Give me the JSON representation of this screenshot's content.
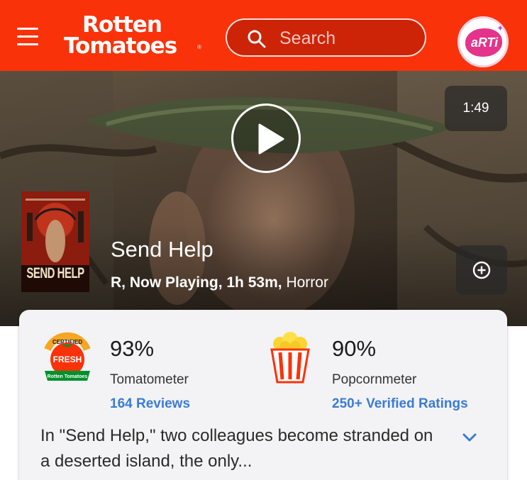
{
  "header": {
    "logo_line1": "Rotten",
    "logo_line2": "Tomatoes",
    "logo_mark": "®",
    "search_placeholder": "Search",
    "avatar_text": "aRTi",
    "brand_color": "#fa320a",
    "icons": {
      "menu": "hamburger-menu-icon",
      "search": "search-icon",
      "avatar": "arti-avatar-icon"
    }
  },
  "hero": {
    "video_duration": "1:49",
    "title": "Send Help",
    "rating": "R,",
    "status": "Now Playing,",
    "runtime": "1h 53m,",
    "genre": "Horror",
    "poster_title": "SEND HELP",
    "icons": {
      "play": "play-icon",
      "add": "add-circle-icon"
    }
  },
  "scores": {
    "tomatometer": {
      "value": "93%",
      "label": "Tomatometer",
      "reviews": "164 Reviews",
      "badge_top": "CERTIFIED",
      "badge_mid": "FRESH",
      "badge_bottom": "Rotten Tomatoes"
    },
    "popcornmeter": {
      "value": "90%",
      "label": "Popcornmeter",
      "ratings": "250+ Verified Ratings"
    },
    "link_color": "#3a7bd5"
  },
  "synopsis": {
    "text": "In \"Send Help,\" two colleagues become stranded on a deserted island, the only...",
    "expand_icon": "chevron-down-icon"
  }
}
